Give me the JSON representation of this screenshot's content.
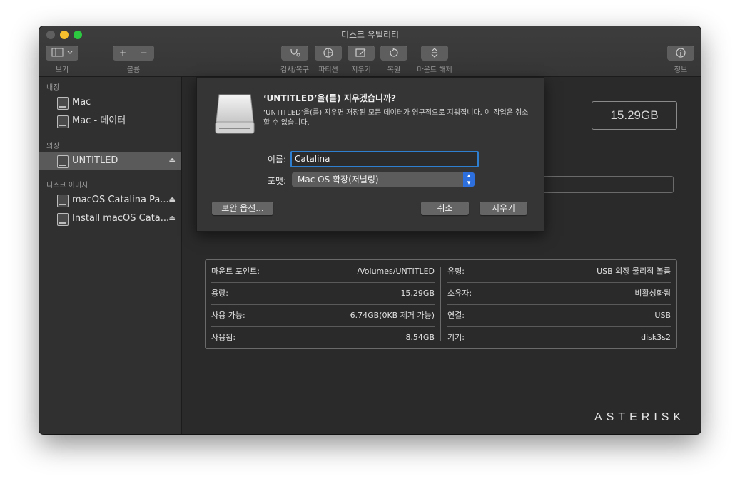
{
  "window": {
    "title": "디스크 유틸리티",
    "traffic_colors": [
      "#5f5f5f",
      "#f5bf2e",
      "#2bc840"
    ]
  },
  "toolbar": {
    "view_label": "보기",
    "volume_label": "볼륨",
    "firstaid_label": "검사/복구",
    "partition_label": "파티션",
    "erase_label": "지우기",
    "restore_label": "복원",
    "unmount_label": "마운트 해제",
    "info_label": "정보",
    "add_symbol": "+",
    "remove_symbol": "−"
  },
  "sidebar": {
    "internal_header": "내장",
    "external_header": "외장",
    "images_header": "디스크 이미지",
    "internal_items": [
      "Mac",
      "Mac - 데이터"
    ],
    "external_items": [
      "UNTITLED"
    ],
    "image_items": [
      "macOS Catalina Pa...",
      "Install macOS Cata..."
    ],
    "eject_symbol": "⏏"
  },
  "main": {
    "capacity": "15.29GB",
    "info": {
      "mount_point_label": "마운트 포인트:",
      "mount_point_value": "/Volumes/UNTITLED",
      "capacity_label": "용량:",
      "capacity_value": "15.29GB",
      "available_label": "사용 가능:",
      "available_value": "6.74GB(0KB 제거 가능)",
      "used_label": "사용됨:",
      "used_value": "8.54GB",
      "type_label": "유형:",
      "type_value": "USB 외장 물리적 볼륨",
      "owners_label": "소유자:",
      "owners_value": "비활성화됨",
      "connection_label": "연결:",
      "connection_value": "USB",
      "device_label": "기기:",
      "device_value": "disk3s2"
    }
  },
  "dialog": {
    "title": "‘UNTITLED’을(를) 지우겠습니까?",
    "message": "‘UNTITLED’을(를) 지우면 저장된 모든 데이터가 영구적으로 지워집니다. 이 작업은 취소할 수 없습니다.",
    "name_label": "이름:",
    "name_value": "Catalina",
    "format_label": "포맷:",
    "format_value": "Mac OS 확장(저널링)",
    "security_button": "보안 옵션...",
    "cancel_button": "취소",
    "erase_button": "지우기"
  },
  "watermark": "ASTERISK"
}
